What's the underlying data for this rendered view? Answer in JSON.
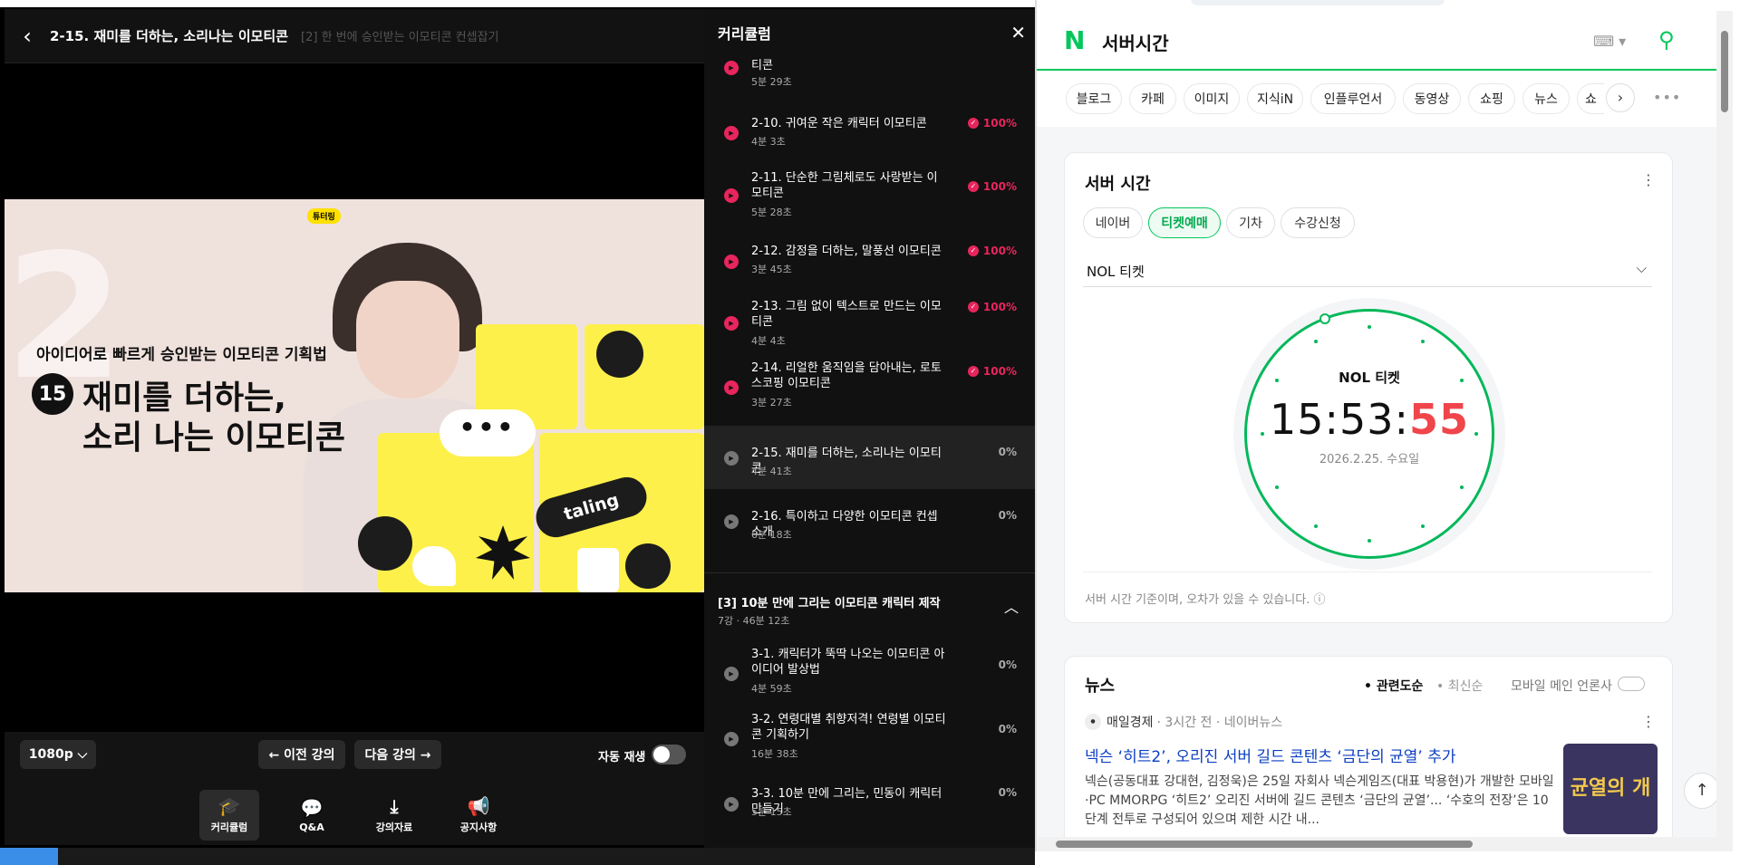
{
  "player": {
    "title": "2-15. 재미를 더하는, 소리나는 이모티콘",
    "subtitle": "[2] 한 번에 승인받는 이모티콘 컨셉잡기",
    "video": {
      "big_number": "2",
      "brand_pill": "튜터링",
      "subtitle_line": "아이디어로 빠르게 승인받는 이모티콘 기획법",
      "number_badge": "15",
      "title_line1": "재미를 더하는,",
      "title_line2": "소리 나는 이모티콘",
      "speech_bubble": "•••",
      "taling": "taling"
    },
    "controls": {
      "quality": "1080p ⌵",
      "prev": "← 이전 강의",
      "next": "다음 강의 →",
      "autoplay": "자동 재생"
    },
    "tabs": [
      {
        "label": "커리큘럼",
        "icon": "graduation-cap-icon"
      },
      {
        "label": "Q&A",
        "icon": "chat-icon"
      },
      {
        "label": "강의자료",
        "icon": "download-icon"
      },
      {
        "label": "공지사항",
        "icon": "megaphone-icon"
      }
    ]
  },
  "curriculum": {
    "header": "커리큘럼",
    "partial_title": "티콘",
    "partial_duration": "5분 29초",
    "lessons": [
      {
        "title": "2-10. 귀여운 작은 캐릭터 이모티콘",
        "duration": "4분 3초",
        "percent": "100%"
      },
      {
        "title": "2-11. 단순한 그림체로도 사랑받는 이모티콘",
        "duration": "5분 28초",
        "percent": "100%"
      },
      {
        "title": "2-12. 감정을 더하는, 말풍선 이모티콘",
        "duration": "3분 45초",
        "percent": "100%"
      },
      {
        "title": "2-13. 그림 없이 텍스트로 만드는 이모티콘",
        "duration": "4분 4초",
        "percent": "100%"
      },
      {
        "title": "2-14. 리얼한 움직임을 담아내는, 로토스코핑 이모티콘",
        "duration": "3분 27초",
        "percent": "100%"
      },
      {
        "title": "2-15. 재미를 더하는, 소리나는 이모티콘",
        "duration": "4분 41초",
        "percent": "0%"
      },
      {
        "title": "2-16. 특이하고 다양한 이모티콘 컨셉 소개",
        "duration": "6분 18초",
        "percent": "0%"
      }
    ],
    "section3": {
      "title": "[3] 10분 만에 그리는 이모티콘 캐릭터 제작",
      "meta": "7강 · 46분 12초"
    },
    "section3_lessons": [
      {
        "title": "3-1. 캐릭터가 뚝딱 나오는 이모티콘 아이디어 발상법",
        "duration": "4분 59초",
        "percent": "0%"
      },
      {
        "title": "3-2. 연령대별 취향저격! 연령별 이모티콘 기획하기",
        "duration": "16분 38초",
        "percent": "0%"
      },
      {
        "title": "3-3. 10분 만에 그리는, 민동이 캐릭터 만들기",
        "duration": "5분 15초",
        "percent": "0%"
      }
    ]
  },
  "browser": {
    "logo": "N",
    "query": "서버시간",
    "chips": [
      "블로그",
      "카페",
      "이미지",
      "지식iN",
      "인플루언서",
      "동영상",
      "쇼핑",
      "뉴스",
      "쇼"
    ],
    "server_time": {
      "title": "서버 시간",
      "tabs": [
        "네이버",
        "티켓예매",
        "기차",
        "수강신청"
      ],
      "selected": "NOL 티켓",
      "clock_label": "NOL 티켓",
      "time_hm": "15:53:",
      "time_s": "55",
      "date": "2026.2.25. 수요일",
      "note": "서버 시간 기준이며, 오차가 있을 수 있습니다. ⓘ"
    },
    "news": {
      "title": "뉴스",
      "sort_relevance": "• 관련도순",
      "sort_latest": "• 최신순",
      "mobile": "모바일 메인 언론사",
      "press": "매일경제",
      "meta": "· 3시간 전 · 네이버뉴스",
      "headline": "넥슨 ‘히트2’, 오리진 서버 길드 콘텐츠 ‘금단의 균열’ 추가",
      "snippet": "넥슨(공동대표 강대현, 김정욱)은 25일 자회사 넥슨게임즈(대표 박용현)가 개발한 모바일·PC MMORPG ‘히트2’ 오리진 서버에 길드 콘텐츠 ‘금단의 균열’... ‘수호의 전장’은 10단계 전투로 구성되어 있으며 제한 시간 내...",
      "thumb_text": "균열의 개방"
    }
  }
}
